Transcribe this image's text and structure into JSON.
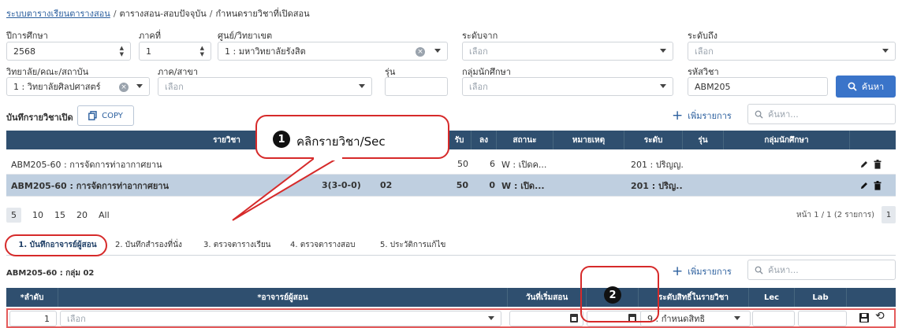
{
  "breadcrumb": {
    "home": "ระบบตารางเรียนตารางสอน",
    "middle": "ตารางสอน-สอบปัจจุบัน",
    "current": "กำหนดรายวิชาที่เปิดสอน",
    "sep": "/"
  },
  "filters": {
    "year_label": "ปีการศึกษา",
    "year_value": "2568",
    "term_label": "ภาคที่",
    "term_value": "1",
    "campus_label": "ศูนย์/วิทยาเขต",
    "campus_value": "1 : มหาวิทยาลัยรังสิต",
    "level_from_label": "ระดับจาก",
    "level_from_placeholder": "เลือก",
    "level_to_label": "ระดับถึง",
    "level_to_placeholder": "เลือก",
    "faculty_label": "วิทยาลัย/คณะ/สถาบัน",
    "faculty_value": "1 : วิทยาลัยศิลปศาสตร์",
    "dept_label": "ภาค/สาขา",
    "dept_placeholder": "เลือก",
    "batch_label": "รุ่น",
    "group_label": "กลุ่มนักศึกษา",
    "group_placeholder": "เลือก",
    "code_label": "รหัสวิชา",
    "code_value": "ABM205",
    "search_button": "ค้นหา"
  },
  "courses": {
    "title": "บันทึกรายวิชาเปิด",
    "copy_label": "COPY",
    "add_label": "เพิ่มรายการ",
    "search_placeholder": "ค้นหา...",
    "headers": [
      "รายวิชา",
      "รับ",
      "ลง",
      "สถานะ",
      "หมายเหตุ",
      "ระดับ",
      "รุ่น",
      "กลุ่มนักศึกษา"
    ],
    "rows": [
      {
        "course": "ABM205-60 : การจัดการท่าอากาศยาน",
        "credits": "",
        "sec": "",
        "accept": "50",
        "enrolled": "6",
        "status": "W : เปิดค...",
        "note": "",
        "level": "201 : ปริญญ...",
        "batch": "",
        "group": ""
      },
      {
        "course": "ABM205-60 : การจัดการท่าอากาศยาน",
        "credits": "3(3-0-0)",
        "sec": "02",
        "accept": "50",
        "enrolled": "0",
        "status": "W : เปิด...",
        "note": "",
        "level": "201 : ปริญ...",
        "batch": "",
        "group": ""
      }
    ]
  },
  "pager": {
    "sizes": [
      "5",
      "10",
      "15",
      "20",
      "All"
    ],
    "info": "หน้า 1 / 1 (2 รายการ)",
    "page": "1"
  },
  "tabs": [
    "1. บันทึกอาจารย์ผู้สอน",
    "2. บันทึกสำรองที่นั่ง",
    "3. ตรวจตารางเรียน",
    "4. ตรวจตารางสอบ",
    "5. ประวัติการแก้ไข"
  ],
  "teachers": {
    "title": "ABM205-60 : กลุ่ม 02",
    "add_label": "เพิ่มรายการ",
    "search_placeholder": "ค้นหา...",
    "headers": [
      "*ลำดับ",
      "*อาจารย์ผู้สอน",
      "วันที่เริ่มสอน",
      "",
      "ระดับสิทธิ์ในรายวิชา",
      "Lec",
      "Lab"
    ],
    "row": {
      "seq": "1",
      "teacher_placeholder": "เลือก",
      "right": "9 : กำหนดสิทธิ"
    }
  },
  "callouts": {
    "one_number": "1",
    "one_text": "คลิกรายวิชา/Sec",
    "two_number": "2"
  },
  "colors": {
    "header": "#2f4f6f",
    "primary": "#3a74c9",
    "selected_row": "#bfcfe0",
    "highlight": "#d62a2a"
  }
}
